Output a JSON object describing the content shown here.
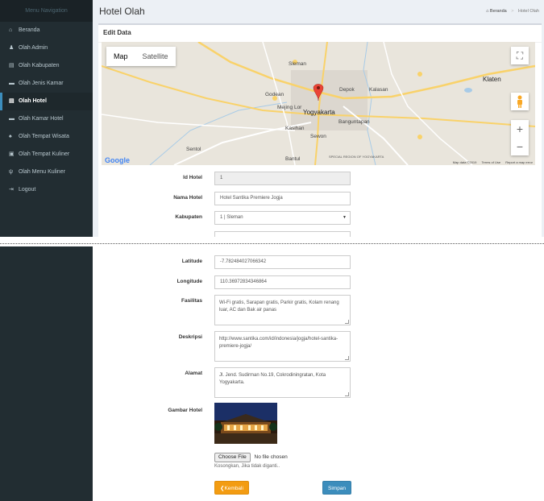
{
  "sidebar": {
    "header": "Menu Navigation",
    "items": [
      {
        "label": "Beranda",
        "icon": "home-icon",
        "glyph": "⌂",
        "active": false
      },
      {
        "label": "Olah Admin",
        "icon": "user-icon",
        "glyph": "♟",
        "active": false
      },
      {
        "label": "Olah Kabupaten",
        "icon": "building-icon",
        "glyph": "▤",
        "active": false
      },
      {
        "label": "Olah Jenis Kamar",
        "icon": "bed-icon",
        "glyph": "▬",
        "active": false
      },
      {
        "label": "Olah Hotel",
        "icon": "building-icon",
        "glyph": "▤",
        "active": true
      },
      {
        "label": "Olah Kamar Hotel",
        "icon": "bed-icon",
        "glyph": "▬",
        "active": false
      },
      {
        "label": "Olah Tempat Wisata",
        "icon": "bell-icon",
        "glyph": "♠",
        "active": false
      },
      {
        "label": "Olah Tempat Kuliner",
        "icon": "image-icon",
        "glyph": "▣",
        "active": false
      },
      {
        "label": "Olah Menu Kuliner",
        "icon": "cutlery-icon",
        "glyph": "ψ",
        "active": false
      },
      {
        "label": "Logout",
        "icon": "sign-out-icon",
        "glyph": "⇥",
        "active": false
      }
    ]
  },
  "header": {
    "title": "Hotel Olah",
    "breadcrumb": {
      "home": "Beranda",
      "current": "Hotel Olah"
    }
  },
  "box": {
    "title": "Edit Data"
  },
  "map": {
    "tab_map": "Map",
    "tab_satellite": "Satellite",
    "logo": "Google",
    "footer": {
      "data": "Map data ©2019",
      "terms": "Terms of Use",
      "report": "Report a map error"
    },
    "places": {
      "sleman": "Sleman",
      "depok": "Depok",
      "klaten": "Klaten",
      "godean": "Godean",
      "kalasan": "Kalasan",
      "mejing_lor": "Mejing Lor",
      "yogyakarta": "Yogyakarta",
      "banguntapan": "Banguntapan",
      "kasihan": "Kasihan",
      "sewon": "Sewon",
      "sentol": "Sentol",
      "bantul": "Bantul",
      "region": "SPECIAL REGION OF YOGYAKARTA"
    }
  },
  "form": {
    "id_label": "Id Hotel",
    "id_value": "1",
    "name_label": "Nama Hotel",
    "name_value": "Hotel Santika Premiere Jogja",
    "kabupaten_label": "Kabupaten",
    "kabupaten_value": "1 | Sleman",
    "latitude_label": "Latitude",
    "latitude_value": "-7.782484027066342",
    "longitude_label": "Longitude",
    "longitude_value": "110.36972834346864",
    "fasilitas_label": "Fasilitas",
    "fasilitas_value": "Wi-Fi gratis,  Sarapan gratis,  Parkir gratis,  Kolam renang luar,  AC dan Bak air panas",
    "deskripsi_label": "Deskripsi",
    "deskripsi_value": "http://www.santika.com/id/indonesia/jogja/hotel-santika-premiere-jogja/",
    "alamat_label": "Alamat",
    "alamat_value": "Jl. Jend. Sudirman No.19, Cokrodiningratan, Kota Yogyakarta.",
    "gambar_label": "Gambar Hotel",
    "file_button": "Choose File",
    "file_status": "No file chosen",
    "file_hint": "Kosongkan, Jika tidak diganti..",
    "back_label": "Kembali",
    "save_label": "Simpan"
  },
  "colors": {
    "sidebar": "#222d32",
    "accent": "#3c8dbc",
    "warning": "#f39c12",
    "map_pin": "#ea4335"
  }
}
